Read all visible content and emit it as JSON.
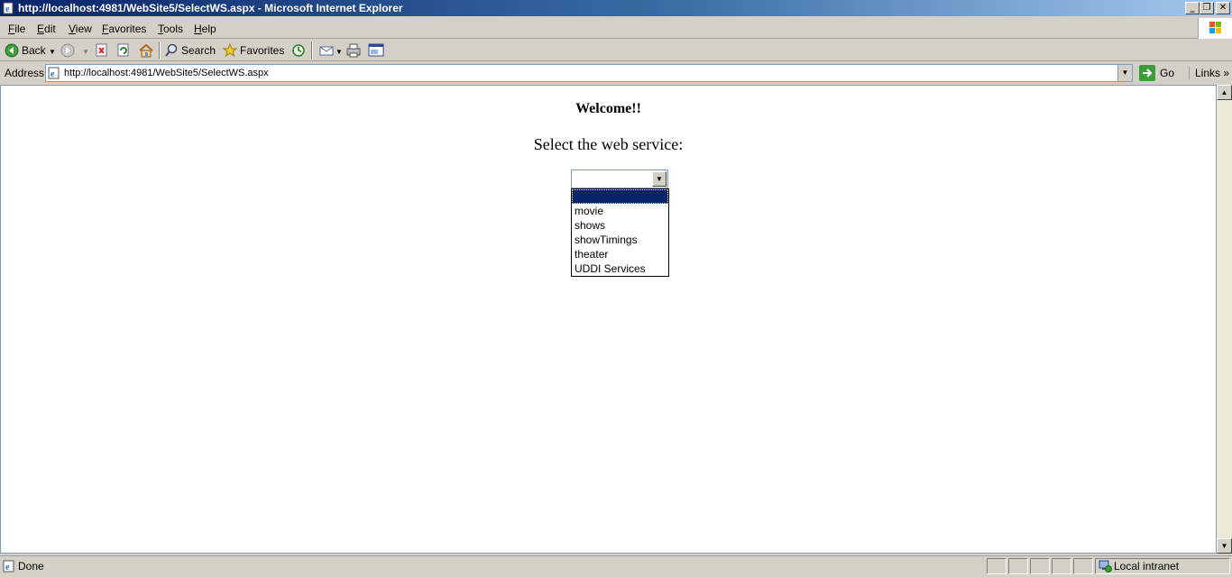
{
  "window": {
    "title": "http://localhost:4981/WebSite5/SelectWS.aspx - Microsoft Internet Explorer",
    "minimize_glyph": "_",
    "restore_glyph": "❐",
    "close_glyph": "✕"
  },
  "menu": {
    "items": [
      "File",
      "Edit",
      "View",
      "Favorites",
      "Tools",
      "Help"
    ]
  },
  "toolbar": {
    "back_label": "Back",
    "search_label": "Search",
    "favorites_label": "Favorites"
  },
  "address": {
    "label": "Address",
    "url": "http://localhost:4981/WebSite5/SelectWS.aspx",
    "go_label": "Go",
    "links_label": "Links",
    "links_chevron": "»"
  },
  "page": {
    "welcome": "Welcome!!",
    "heading": "Select the web service:",
    "select": {
      "selected_value": "",
      "options": [
        "",
        "movie",
        "shows",
        "showTimings",
        "theater",
        "UDDI Services"
      ]
    }
  },
  "status": {
    "text": "Done",
    "zone": "Local intranet"
  },
  "colors": {
    "titlebar_start": "#0a246a",
    "titlebar_end": "#a6caf0",
    "selection": "#0a246a",
    "chrome": "#d4d0c8"
  }
}
